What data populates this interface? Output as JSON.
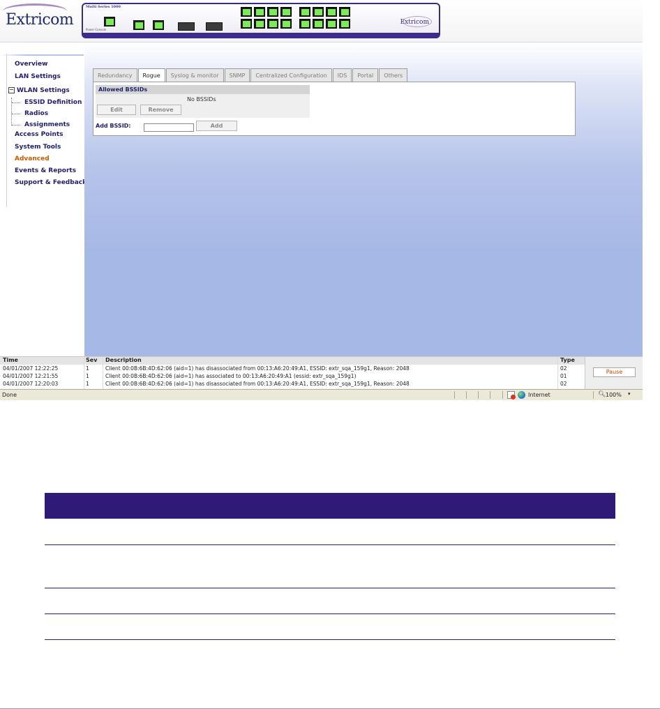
{
  "header": {
    "logo_text": "Extricom",
    "device_series": "Multi Series 1000",
    "device_caption": "Power   Console",
    "device_brand": "Extricom"
  },
  "nav": {
    "items": [
      {
        "label": "Overview"
      },
      {
        "label": "LAN Settings"
      },
      {
        "label": "WLAN Settings"
      },
      {
        "label": "ESSID Definition"
      },
      {
        "label": "Radios"
      },
      {
        "label": "Assignments"
      },
      {
        "label": "Access Points"
      },
      {
        "label": "System Tools"
      },
      {
        "label": "Advanced"
      },
      {
        "label": "Events & Reports"
      },
      {
        "label": "Support & Feedback"
      }
    ],
    "expander": "−"
  },
  "tabs": [
    {
      "label": "Redundancy"
    },
    {
      "label": "Rogue"
    },
    {
      "label": "Syslog & monitor"
    },
    {
      "label": "SNMP"
    },
    {
      "label": "Centralized Configuration"
    },
    {
      "label": "IDS"
    },
    {
      "label": "Portal"
    },
    {
      "label": "Others"
    }
  ],
  "rogue": {
    "allowed_header": "Allowed BSSIDs",
    "empty_text": "No BSSIDs",
    "edit_label": "Edit",
    "remove_label": "Remove",
    "add_label": "Add BSSID:",
    "add_input_value": "",
    "add_button_label": "Add"
  },
  "log": {
    "columns": [
      "Time",
      "Sev",
      "Description",
      "Type"
    ],
    "rows": [
      [
        "04/01/2007 12:22:25",
        "1",
        "Client 00:0B:6B:4D:62:06 (aid=1) has disassociated from 00:13:A6:20:49:A1, ESSID: extr_sqa_159g1, Reason: 2048",
        "02"
      ],
      [
        "04/01/2007 12:21:55",
        "1",
        "Client 00:0B:6B:4D:62:06 (aid=1) has associated to 00:13:A6:20:49:A1 (essid: extr_sqa_159g1)",
        "01"
      ],
      [
        "04/01/2007 12:20:03",
        "1",
        "Client 00:0B:6B:4D:62:06 (aid=1) has disassociated from 00:13:A6:20:49:A1, ESSID: extr_sqa_159g1, Reason: 2048",
        "02"
      ]
    ],
    "pause_label": "Pause"
  },
  "statusbar": {
    "text": "Done",
    "zone": "Internet",
    "zoom": "100%"
  },
  "colors": {
    "accent_navy": "#1e1e6e",
    "active_orange": "#cc5a00",
    "brand_purple": "#2f1a78"
  }
}
